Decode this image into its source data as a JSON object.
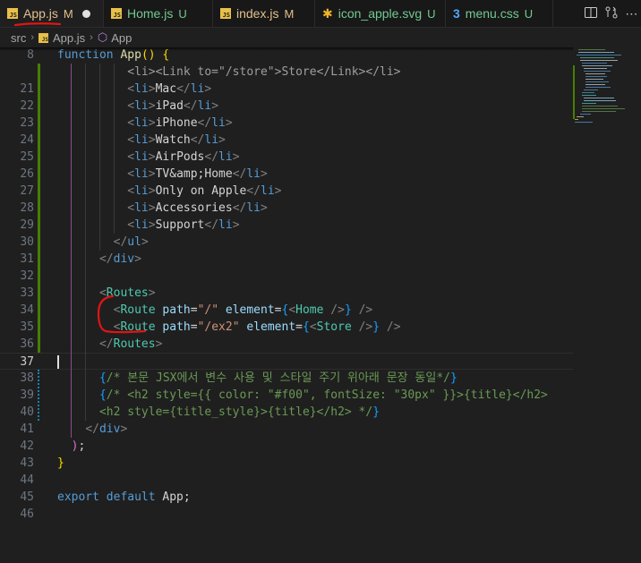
{
  "tabs": [
    {
      "name": "App.js",
      "icon": "js-icon",
      "status": "M",
      "active": true,
      "dirty": true
    },
    {
      "name": "Home.js",
      "icon": "js-icon",
      "status": "U"
    },
    {
      "name": "index.js",
      "icon": "js-icon",
      "status": "M"
    },
    {
      "name": "icon_apple.svg",
      "icon": "svg-icon",
      "status": "U"
    },
    {
      "name": "menu.css",
      "icon": "css-icon",
      "status": "U"
    }
  ],
  "tab_actions": {
    "split_label": "⫿",
    "more_label": "⋯"
  },
  "breadcrumb": {
    "folder": "src",
    "file": "App.js",
    "symbol": "App",
    "sep": "›"
  },
  "icons": {
    "js": "JS",
    "svg": "✱",
    "css": "3",
    "cube": "⬡"
  },
  "gutter": {
    "modified_color": "#487e02",
    "dirty_color": "#1b81a8"
  },
  "lines": [
    {
      "n": "8",
      "tokens": [
        [
          "kw",
          "function "
        ],
        [
          "fn",
          "App"
        ],
        [
          "br1",
          "() {"
        ]
      ]
    },
    {
      "n": "",
      "tokens": [
        [
          "dim",
          "          <li><Link to=\"/store\">Store</Link></li>"
        ]
      ]
    },
    {
      "n": "21",
      "tokens": [
        [
          "txt",
          "          "
        ],
        [
          "punc",
          "<"
        ],
        [
          "tag",
          "li"
        ],
        [
          "punc",
          ">"
        ],
        [
          "txt",
          "Mac"
        ],
        [
          "punc",
          "</"
        ],
        [
          "tag",
          "li"
        ],
        [
          "punc",
          ">"
        ]
      ]
    },
    {
      "n": "22",
      "tokens": [
        [
          "txt",
          "          "
        ],
        [
          "punc",
          "<"
        ],
        [
          "tag",
          "li"
        ],
        [
          "punc",
          ">"
        ],
        [
          "txt",
          "iPad"
        ],
        [
          "punc",
          "</"
        ],
        [
          "tag",
          "li"
        ],
        [
          "punc",
          ">"
        ]
      ]
    },
    {
      "n": "23",
      "tokens": [
        [
          "txt",
          "          "
        ],
        [
          "punc",
          "<"
        ],
        [
          "tag",
          "li"
        ],
        [
          "punc",
          ">"
        ],
        [
          "txt",
          "iPhone"
        ],
        [
          "punc",
          "</"
        ],
        [
          "tag",
          "li"
        ],
        [
          "punc",
          ">"
        ]
      ]
    },
    {
      "n": "24",
      "tokens": [
        [
          "txt",
          "          "
        ],
        [
          "punc",
          "<"
        ],
        [
          "tag",
          "li"
        ],
        [
          "punc",
          ">"
        ],
        [
          "txt",
          "Watch"
        ],
        [
          "punc",
          "</"
        ],
        [
          "tag",
          "li"
        ],
        [
          "punc",
          ">"
        ]
      ]
    },
    {
      "n": "25",
      "tokens": [
        [
          "txt",
          "          "
        ],
        [
          "punc",
          "<"
        ],
        [
          "tag",
          "li"
        ],
        [
          "punc",
          ">"
        ],
        [
          "txt",
          "AirPods"
        ],
        [
          "punc",
          "</"
        ],
        [
          "tag",
          "li"
        ],
        [
          "punc",
          ">"
        ]
      ]
    },
    {
      "n": "26",
      "tokens": [
        [
          "txt",
          "          "
        ],
        [
          "punc",
          "<"
        ],
        [
          "tag",
          "li"
        ],
        [
          "punc",
          ">"
        ],
        [
          "txt",
          "TV&amp;Home"
        ],
        [
          "punc",
          "</"
        ],
        [
          "tag",
          "li"
        ],
        [
          "punc",
          ">"
        ]
      ]
    },
    {
      "n": "27",
      "tokens": [
        [
          "txt",
          "          "
        ],
        [
          "punc",
          "<"
        ],
        [
          "tag",
          "li"
        ],
        [
          "punc",
          ">"
        ],
        [
          "txt",
          "Only on Apple"
        ],
        [
          "punc",
          "</"
        ],
        [
          "tag",
          "li"
        ],
        [
          "punc",
          ">"
        ]
      ]
    },
    {
      "n": "28",
      "tokens": [
        [
          "txt",
          "          "
        ],
        [
          "punc",
          "<"
        ],
        [
          "tag",
          "li"
        ],
        [
          "punc",
          ">"
        ],
        [
          "txt",
          "Accessories"
        ],
        [
          "punc",
          "</"
        ],
        [
          "tag",
          "li"
        ],
        [
          "punc",
          ">"
        ]
      ]
    },
    {
      "n": "29",
      "tokens": [
        [
          "txt",
          "          "
        ],
        [
          "punc",
          "<"
        ],
        [
          "tag",
          "li"
        ],
        [
          "punc",
          ">"
        ],
        [
          "txt",
          "Support"
        ],
        [
          "punc",
          "</"
        ],
        [
          "tag",
          "li"
        ],
        [
          "punc",
          ">"
        ]
      ]
    },
    {
      "n": "30",
      "tokens": [
        [
          "txt",
          "        "
        ],
        [
          "punc",
          "</"
        ],
        [
          "tag",
          "ul"
        ],
        [
          "punc",
          ">"
        ]
      ]
    },
    {
      "n": "31",
      "tokens": [
        [
          "txt",
          "      "
        ],
        [
          "punc",
          "</"
        ],
        [
          "tag",
          "div"
        ],
        [
          "punc",
          ">"
        ]
      ]
    },
    {
      "n": "32",
      "tokens": []
    },
    {
      "n": "33",
      "tokens": [
        [
          "txt",
          "      "
        ],
        [
          "punc",
          "<"
        ],
        [
          "comp",
          "Routes"
        ],
        [
          "punc",
          ">"
        ]
      ]
    },
    {
      "n": "34",
      "tokens": [
        [
          "txt",
          "        "
        ],
        [
          "punc",
          "<"
        ],
        [
          "comp",
          "Route"
        ],
        [
          "txt",
          " "
        ],
        [
          "attr",
          "path"
        ],
        [
          "txt",
          "="
        ],
        [
          "str",
          "\"/\""
        ],
        [
          "txt",
          " "
        ],
        [
          "attr",
          "element"
        ],
        [
          "txt",
          "="
        ],
        [
          "br3",
          "{"
        ],
        [
          "punc",
          "<"
        ],
        [
          "comp",
          "Home"
        ],
        [
          "txt",
          " "
        ],
        [
          "punc",
          "/>"
        ],
        [
          "br3",
          "}"
        ],
        [
          "txt",
          " "
        ],
        [
          "punc",
          "/>"
        ]
      ]
    },
    {
      "n": "35",
      "tokens": [
        [
          "txt",
          "        "
        ],
        [
          "punc",
          "<"
        ],
        [
          "comp",
          "Route"
        ],
        [
          "txt",
          " "
        ],
        [
          "attr",
          "path"
        ],
        [
          "txt",
          "="
        ],
        [
          "str",
          "\"/ex2\""
        ],
        [
          "txt",
          " "
        ],
        [
          "attr",
          "element"
        ],
        [
          "txt",
          "="
        ],
        [
          "br3",
          "{"
        ],
        [
          "punc",
          "<"
        ],
        [
          "comp",
          "Store"
        ],
        [
          "txt",
          " "
        ],
        [
          "punc",
          "/>"
        ],
        [
          "br3",
          "}"
        ],
        [
          "txt",
          " "
        ],
        [
          "punc",
          "/>"
        ]
      ]
    },
    {
      "n": "36",
      "tokens": [
        [
          "txt",
          "      "
        ],
        [
          "punc",
          "</"
        ],
        [
          "comp",
          "Routes"
        ],
        [
          "punc",
          ">"
        ]
      ]
    },
    {
      "n": "37",
      "tokens": [],
      "current": true
    },
    {
      "n": "38",
      "tokens": [
        [
          "txt",
          "      "
        ],
        [
          "br3",
          "{"
        ],
        [
          "com",
          "/* 본문 JSX에서 변수 사용 및 스타일 주기 위아래 문장 동일*/"
        ],
        [
          "br3",
          "}"
        ]
      ]
    },
    {
      "n": "39",
      "tokens": [
        [
          "txt",
          "      "
        ],
        [
          "br3",
          "{"
        ],
        [
          "com",
          "/* <h2 style={{ color: \"#f00\", fontSize: \"30px\" }}>{title}</h2>"
        ]
      ]
    },
    {
      "n": "40",
      "tokens": [
        [
          "txt",
          "      "
        ],
        [
          "com",
          "<h2 style={title_style}>{title}</h2> */"
        ],
        [
          "br3",
          "}"
        ]
      ]
    },
    {
      "n": "41",
      "tokens": [
        [
          "txt",
          "    "
        ],
        [
          "punc",
          "</"
        ],
        [
          "tag",
          "div"
        ],
        [
          "punc",
          ">"
        ]
      ]
    },
    {
      "n": "42",
      "tokens": [
        [
          "txt",
          "  "
        ],
        [
          "br2",
          ")"
        ],
        [
          "txt",
          ";"
        ]
      ]
    },
    {
      "n": "43",
      "tokens": [
        [
          "br1",
          "}"
        ]
      ]
    },
    {
      "n": "44",
      "tokens": []
    },
    {
      "n": "45",
      "tokens": [
        [
          "kw",
          "export default "
        ],
        [
          "txt",
          "App;"
        ]
      ]
    },
    {
      "n": "46",
      "tokens": []
    }
  ]
}
